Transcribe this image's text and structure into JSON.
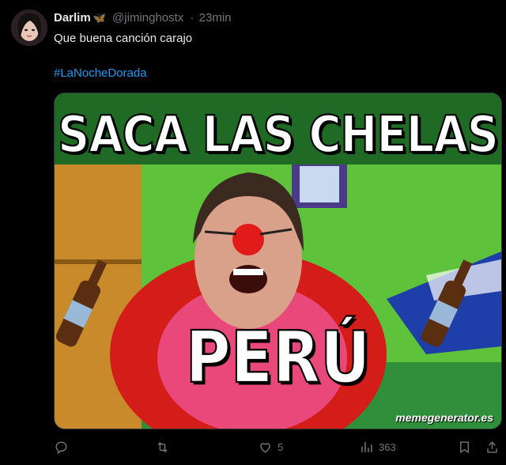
{
  "tweet": {
    "author_name": "Darlim",
    "author_badge_icon": "butterfly-icon",
    "handle": "@jiminghostx",
    "separator": "·",
    "time": "23min",
    "text": "Que buena canción carajo",
    "hashtag": "#LaNocheDorada"
  },
  "media": {
    "top_text": "SACA LAS CHELAS",
    "bottom_text": "PERÚ",
    "watermark": "memegenerator.es"
  },
  "actions": {
    "reply_icon": "reply-icon",
    "retweet_icon": "retweet-icon",
    "like_icon": "heart-icon",
    "like_count": "5",
    "views_icon": "views-icon",
    "views_count": "363",
    "share_icon": "share-icon"
  },
  "colors": {
    "background": "#000000",
    "link": "#1d9bf0",
    "muted": "#71767b"
  }
}
